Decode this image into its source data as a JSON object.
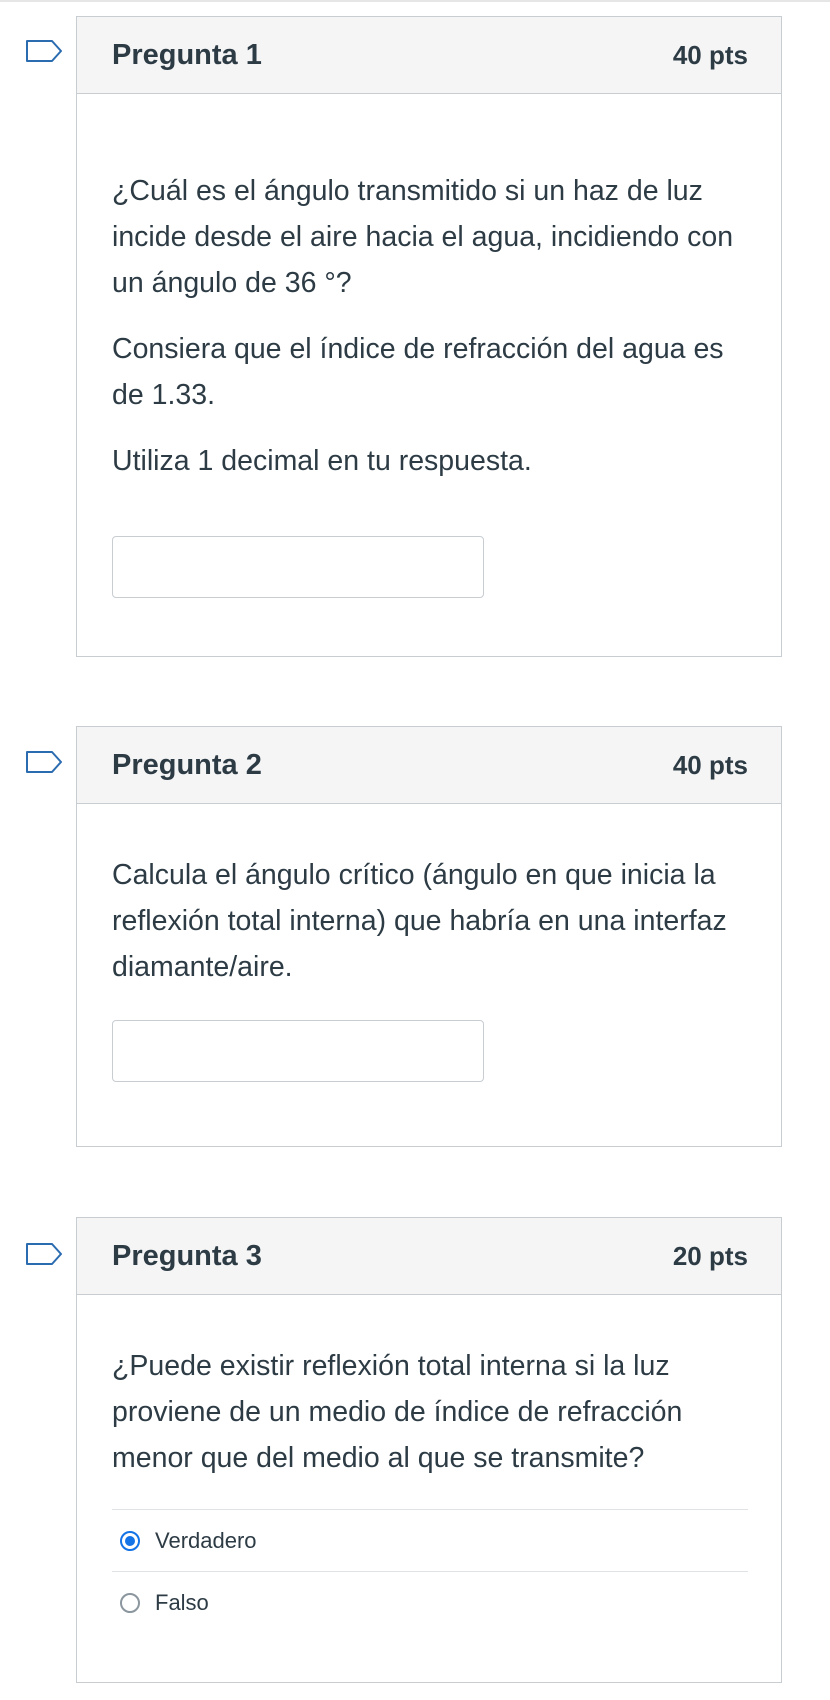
{
  "questions": [
    {
      "title": "Pregunta 1",
      "points": "40 pts",
      "paragraphs": [
        "¿Cuál es el ángulo transmitido si un haz de luz incide desde el aire hacia el agua, incidiendo con un ángulo de 36 °?",
        "Consiera que el índice de refracción del agua es de 1.33.",
        "Utiliza 1 decimal en tu respuesta."
      ],
      "answer_value": ""
    },
    {
      "title": "Pregunta 2",
      "points": "40 pts",
      "paragraphs": [
        "Calcula el ángulo crítico (ángulo en que inicia la reflexión total interna) que habría en una interfaz diamante/aire."
      ],
      "answer_value": ""
    },
    {
      "title": "Pregunta 3",
      "points": "20 pts",
      "paragraphs": [
        "¿Puede existir reflexión total interna si la luz proviene de un medio de índice de refracción menor que del medio al que se transmite?"
      ],
      "options": [
        {
          "label": "Verdadero",
          "selected": true
        },
        {
          "label": "Falso",
          "selected": false
        }
      ]
    }
  ],
  "colors": {
    "accent": "#1473e6",
    "flag_stroke": "#2b6cb0",
    "header_bg": "#f5f5f5",
    "border": "#c7cdd1",
    "text": "#2d3b45"
  },
  "icons": {
    "flag": "flag-icon",
    "radio_selected": "radio-selected-icon",
    "radio_unselected": "radio-unselected-icon"
  }
}
